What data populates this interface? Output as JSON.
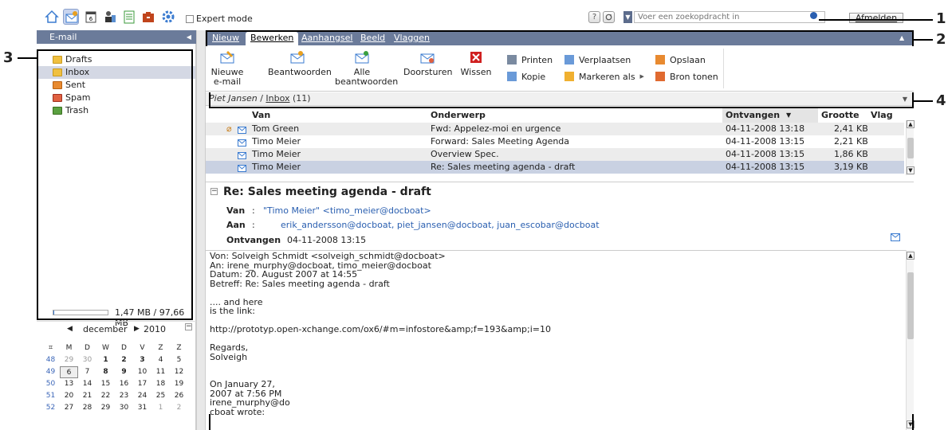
{
  "toolbar": {
    "icons": [
      "home-icon",
      "email-icon",
      "calendar-icon",
      "contacts-icon",
      "tasks-icon",
      "infostore-icon",
      "settings-icon"
    ],
    "expert_mode_label": "Expert mode",
    "help_label": "?",
    "search_placeholder": "Voer een zoekopdracht in",
    "logout_label": "Afmelden"
  },
  "sidebar": {
    "title": "E-mail",
    "folders": [
      {
        "label": "Drafts",
        "selected": false
      },
      {
        "label": "Inbox",
        "selected": true
      },
      {
        "label": "Sent",
        "selected": false
      },
      {
        "label": "Spam",
        "selected": false
      },
      {
        "label": "Trash",
        "selected": false
      }
    ],
    "quota": "1,47 MB / 97,66 MB"
  },
  "calendar": {
    "month": "december",
    "year": "2010",
    "weekdays": [
      "M",
      "D",
      "W",
      "D",
      "V",
      "Z",
      "Z"
    ],
    "weeks": [
      {
        "wk": "48",
        "days": [
          "29",
          "30",
          "1",
          "2",
          "3",
          "4",
          "5"
        ]
      },
      {
        "wk": "49",
        "days": [
          "6",
          "7",
          "8",
          "9",
          "10",
          "11",
          "12"
        ]
      },
      {
        "wk": "50",
        "days": [
          "13",
          "14",
          "15",
          "16",
          "17",
          "18",
          "19"
        ]
      },
      {
        "wk": "51",
        "days": [
          "20",
          "21",
          "22",
          "23",
          "24",
          "25",
          "26"
        ]
      },
      {
        "wk": "52",
        "days": [
          "27",
          "28",
          "29",
          "30",
          "31",
          "1",
          "2"
        ]
      }
    ]
  },
  "tabs": [
    "Nieuw",
    "Bewerken",
    "Aanhangsel",
    "Beeld",
    "Vlaggen"
  ],
  "active_tab": "Bewerken",
  "ribbon": {
    "new_email": "Nieuwe\ne-mail",
    "reply": "Beantwoorden",
    "reply_all": "Alle\nbeantwoorden",
    "forward": "Doorsturen",
    "delete": "Wissen",
    "print": "Printen",
    "copy": "Kopie",
    "move": "Verplaatsen",
    "mark_as": "Markeren als",
    "save": "Opslaan",
    "show_source": "Bron tonen"
  },
  "breadcrumb": {
    "user": "Piet Jansen",
    "sep": " / ",
    "folder": "Inbox",
    "count": " (11)"
  },
  "list": {
    "columns": {
      "from": "Van",
      "subject": "Onderwerp",
      "received": "Ontvangen",
      "size": "Grootte",
      "flag": "Vlag"
    },
    "rows": [
      {
        "from": "Tom Green",
        "subject": "Fwd: Appelez-moi en urgence",
        "received": "04-11-2008 13:18",
        "size": "2,41 KB",
        "attachment": true
      },
      {
        "from": "Timo Meier",
        "subject": "Forward: Sales Meeting Agenda",
        "received": "04-11-2008 13:15",
        "size": "2,21 KB",
        "attachment": false
      },
      {
        "from": "Timo Meier",
        "subject": "Overview Spec.",
        "received": "04-11-2008 13:15",
        "size": "1,86 KB",
        "attachment": false
      },
      {
        "from": "Timo Meier",
        "subject": "Re: Sales meeting agenda - draft",
        "received": "04-11-2008 13:15",
        "size": "3,19 KB",
        "attachment": false
      }
    ]
  },
  "message": {
    "subject": "Re: Sales meeting agenda - draft",
    "from_label": "Van",
    "from": "\"Timo Meier\" <timo_meier@docboat>",
    "to_label": "Aan",
    "to": "erik_andersson@docboat, piet_jansen@docboat, juan_escobar@docboat",
    "received_label": "Ontvangen",
    "received": "04-11-2008 13:15",
    "body": "Von: Solveigh Schmidt <solveigh_schmidt@docboat>\nAn: irene_murphy@docboat, timo_meier@docboat\nDatum: 20. August 2007 at 14:55\nBetreff: Re: Sales meeting agenda - draft\n\n.... and here\nis the link:\n\nhttp://prototyp.open-xchange.com/ox6/#m=infostore&amp;f=193&amp;i=10\n\nRegards,\nSolveigh\n\n\nOn January 27,\n2007 at 7:56 PM\nirene_murphy@do\ncboat wrote:"
  },
  "callouts": [
    "1",
    "2",
    "3",
    "4"
  ]
}
